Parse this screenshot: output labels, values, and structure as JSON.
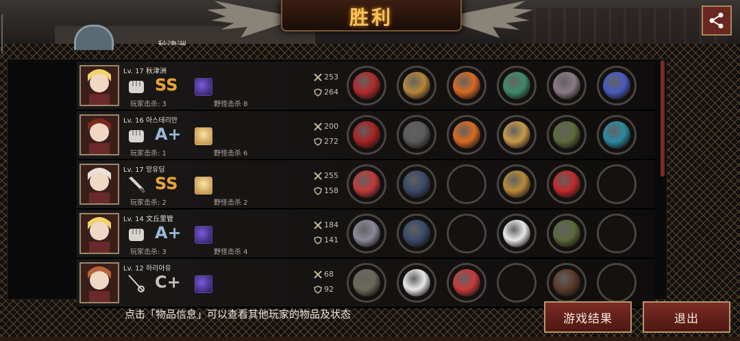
{
  "header": {
    "title": "胜利",
    "top_name": "秋津洲"
  },
  "players": [
    {
      "level_name": "Lv. 17 秋津洲",
      "weapon": "fist-icon",
      "grade": "SS",
      "buff": "dark",
      "player_kills": "玩家击杀: 3",
      "monster_kills": "野怪击杀 8",
      "attack": "253",
      "defense": "264",
      "portrait_color": "#f1d46a",
      "items": [
        "#b22a2a",
        "#b5873a",
        "#d86a22",
        "#3e8a6a",
        "#8a7a86",
        "#4a5ac0"
      ]
    },
    {
      "level_name": "Lv. 16 아스테리안",
      "weapon": "fist-icon",
      "grade": "A+",
      "buff": "gold",
      "player_kills": "玩家击杀: 1",
      "monster_kills": "野怪击杀 6",
      "attack": "200",
      "defense": "272",
      "portrait_color": "#7a2a1e",
      "items": [
        "#a82222",
        "#5a5a5a",
        "#d86a22",
        "#c69a4a",
        "#5a6a3a",
        "#2a8aa0"
      ]
    },
    {
      "level_name": "Lv. 17 앙유딩",
      "weapon": "knife-icon",
      "grade": "SS",
      "buff": "gold",
      "player_kills": "玩家击杀: 2",
      "monster_kills": "野怪击杀 2",
      "attack": "255",
      "defense": "158",
      "portrait_color": "#e8e2da",
      "items": [
        "#c03a3a",
        "#3a4a6a",
        "",
        "#b78a3a",
        "#c02a2a",
        ""
      ]
    },
    {
      "level_name": "Lv. 14 文丘里管",
      "weapon": "fist-icon",
      "grade": "A+",
      "buff": "dark",
      "player_kills": "玩家击杀: 3",
      "monster_kills": "野怪击杀 4",
      "attack": "184",
      "defense": "141",
      "portrait_color": "#f1d46a",
      "items": [
        "#8a8a9a",
        "#3a4a6a",
        "",
        "#e8e8ea",
        "#5a6a3a",
        ""
      ]
    },
    {
      "level_name": "Lv. 12 하리아유",
      "weapon": "rapier-icon",
      "grade": "C+",
      "buff": "dark",
      "player_kills": "",
      "monster_kills": "",
      "attack": "68",
      "defense": "92",
      "portrait_color": "#b8623a",
      "items": [
        "#6a6a5a",
        "#e8e8ea",
        "#c83a3a",
        "",
        "#5a3a2a",
        ""
      ]
    }
  ],
  "footer": {
    "hint": "点击「物品信息」可以查看其他玩家的物品及状态",
    "results_label": "游戏结果",
    "exit_label": "退出"
  }
}
